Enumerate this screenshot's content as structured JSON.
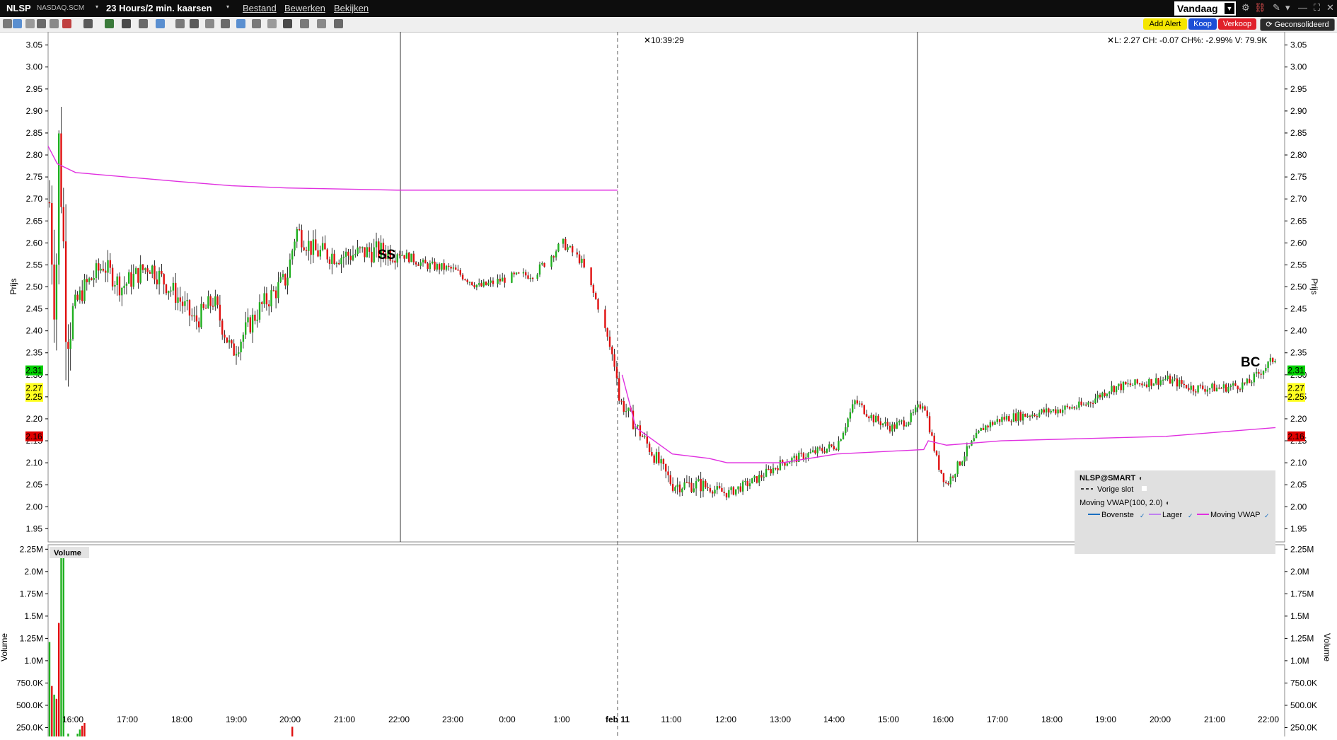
{
  "window": {
    "symbol": "NLSP",
    "exchange": "NASDAQ.SCM",
    "period": "23 Hours/2 min. kaarsen",
    "menus": [
      "Bestand",
      "Bewerken",
      "Bekijken"
    ],
    "range_select": "Vandaag"
  },
  "toolbar": {
    "add_alert": "Add Alert",
    "buy": "Koop",
    "sell": "Verkoop",
    "consolidated": "Geconsolideerd"
  },
  "colors": {
    "up": "#20b020",
    "down": "#e01010",
    "vwap": "#e030e0",
    "bid_tag": "#00d000",
    "last_tag": "#ffff20",
    "ask_tag": "#e00000"
  },
  "chart_data": [
    {
      "type": "candlestick",
      "ylabel": "Prijs",
      "ylim": [
        1.92,
        3.08
      ],
      "y_ticks": [
        "1.95",
        "2.00",
        "2.05",
        "2.10",
        "2.15",
        "2.20",
        "2.25",
        "2.30",
        "2.35",
        "2.40",
        "2.45",
        "2.50",
        "2.55",
        "2.60",
        "2.65",
        "2.70",
        "2.75",
        "2.80",
        "2.85",
        "2.90",
        "2.95",
        "3.00",
        "3.05"
      ],
      "x_labels": [
        "16:00",
        "17:00",
        "18:00",
        "19:00",
        "20:00",
        "21:00",
        "22:00",
        "23:00",
        "0:00",
        "1:00",
        "feb 11",
        "11:00",
        "12:00",
        "13:00",
        "14:00",
        "15:00",
        "16:00",
        "17:00",
        "18:00",
        "19:00",
        "20:00",
        "21:00",
        "22:00"
      ],
      "crosshair_time": "10:39:29",
      "quote_line": "L: 2.27  CH: -0.07  CH%: -2.99%  V: 79.9K",
      "price_tags": {
        "bid": "2.31",
        "last": "2.27",
        "prev": "2.25",
        "ask": "2.16"
      },
      "annotations": [
        "SS",
        "BC"
      ],
      "ohlc_profile": {
        "note": "approximate closing path of 2-min candles",
        "anchors": [
          [
            "15:40",
            2.75
          ],
          [
            "15:48",
            2.45
          ],
          [
            "15:52",
            2.85
          ],
          [
            "16:00",
            2.42
          ],
          [
            "16:20",
            2.5
          ],
          [
            "16:40",
            2.55
          ],
          [
            "17:00",
            2.5
          ],
          [
            "17:30",
            2.55
          ],
          [
            "18:00",
            2.48
          ],
          [
            "18:20",
            2.42
          ],
          [
            "18:40",
            2.47
          ],
          [
            "19:00",
            2.35
          ],
          [
            "19:30",
            2.45
          ],
          [
            "20:00",
            2.52
          ],
          [
            "20:10",
            2.63
          ],
          [
            "20:30",
            2.58
          ],
          [
            "21:00",
            2.57
          ],
          [
            "21:30",
            2.58
          ],
          [
            "22:00",
            2.58
          ],
          [
            "22:30",
            2.55
          ],
          [
            "23:00",
            2.54
          ],
          [
            "23:30",
            2.5
          ],
          [
            "0:00",
            2.52
          ],
          [
            "0:30",
            2.53
          ],
          [
            "1:00",
            2.6
          ],
          [
            "1:20",
            2.56
          ],
          [
            "1:40",
            2.45
          ],
          [
            "2:00",
            2.3
          ],
          [
            "10:00",
            2.25
          ],
          [
            "10:30",
            2.15
          ],
          [
            "11:00",
            2.05
          ],
          [
            "11:30",
            2.05
          ],
          [
            "12:00",
            2.03
          ],
          [
            "12:30",
            2.06
          ],
          [
            "13:00",
            2.1
          ],
          [
            "13:30",
            2.12
          ],
          [
            "14:00",
            2.14
          ],
          [
            "14:20",
            2.24
          ],
          [
            "14:40",
            2.2
          ],
          [
            "15:00",
            2.18
          ],
          [
            "15:20",
            2.2
          ],
          [
            "15:35",
            2.24
          ],
          [
            "15:50",
            2.1
          ],
          [
            "16:00",
            2.05
          ],
          [
            "16:20",
            2.12
          ],
          [
            "16:40",
            2.18
          ],
          [
            "17:00",
            2.2
          ],
          [
            "17:30",
            2.21
          ],
          [
            "18:00",
            2.22
          ],
          [
            "18:30",
            2.23
          ],
          [
            "19:00",
            2.27
          ],
          [
            "19:30",
            2.28
          ],
          [
            "20:00",
            2.29
          ],
          [
            "20:30",
            2.27
          ],
          [
            "21:00",
            2.27
          ],
          [
            "21:30",
            2.28
          ],
          [
            "22:00",
            2.34
          ]
        ]
      },
      "vwap_series": [
        [
          "15:40",
          2.82
        ],
        [
          "15:50",
          2.78
        ],
        [
          "16:10",
          2.76
        ],
        [
          "18:00",
          2.74
        ],
        [
          "19:00",
          2.73
        ],
        [
          "20:00",
          2.725
        ],
        [
          "22:00",
          2.72
        ],
        [
          "2:00",
          2.72
        ],
        [
          "10:05",
          2.3
        ],
        [
          "10:20",
          2.18
        ],
        [
          "11:00",
          2.12
        ],
        [
          "11:40",
          2.11
        ],
        [
          "12:00",
          2.1
        ],
        [
          "13:00",
          2.1
        ],
        [
          "14:00",
          2.12
        ],
        [
          "15:35",
          2.13
        ],
        [
          "15:40",
          2.15
        ],
        [
          "16:00",
          2.14
        ],
        [
          "17:00",
          2.15
        ],
        [
          "20:00",
          2.16
        ],
        [
          "22:00",
          2.18
        ]
      ],
      "legend": {
        "symbol": "NLSP@SMART",
        "prev_close": "Vorige slot",
        "study": "Moving VWAP(100, 2.0)",
        "items": [
          "Bovenste",
          "Lager",
          "Moving VWAP"
        ]
      }
    },
    {
      "type": "bar",
      "title": "Volume",
      "ylabel": "Volume",
      "ylim": [
        0,
        2300000
      ],
      "y_ticks": [
        "250.0K",
        "500.0K",
        "750.0K",
        "1.0M",
        "1.25M",
        "1.5M",
        "1.75M",
        "2.0M",
        "2.25M"
      ],
      "peaks": [
        [
          "15:44",
          1.55
        ],
        [
          "15:48",
          1.7
        ],
        [
          "15:52",
          2.25
        ],
        [
          "16:00",
          0.45
        ],
        [
          "20:00",
          0.25
        ],
        [
          "22:00",
          0.12
        ],
        [
          "14:00",
          0.05
        ]
      ]
    }
  ]
}
